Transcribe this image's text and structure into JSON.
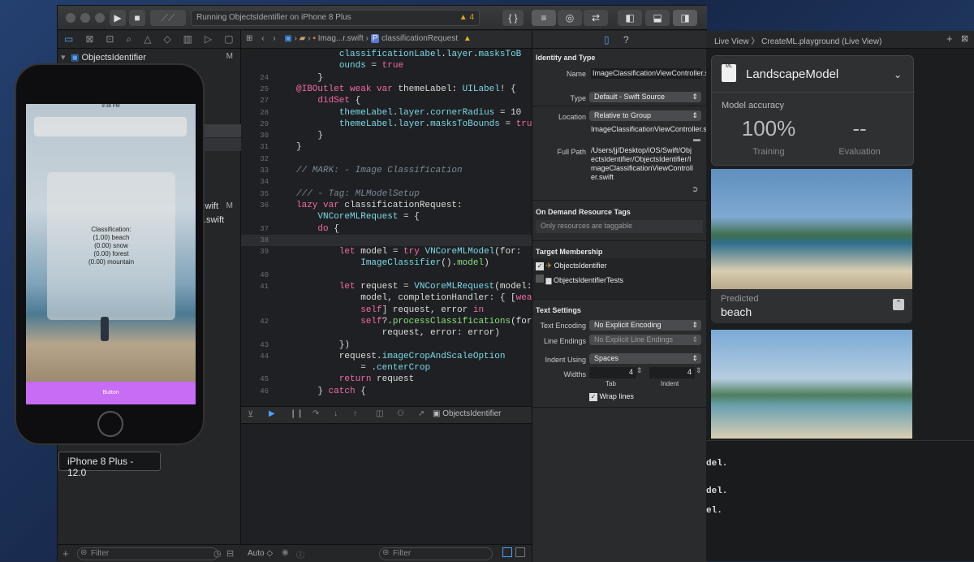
{
  "toolbar": {
    "status": "Running ObjectsIdentifier on iPhone 8 Plus",
    "warning_count": "4",
    "braces": "{ }"
  },
  "navigator": {
    "project": "ObjectsIdentifier",
    "project_badge": "M",
    "rows": [
      {
        "label": "swift",
        "badge": "M"
      },
      {
        "label": ".swift",
        "badge": ""
      }
    ],
    "filter_placeholder": "Filter"
  },
  "editor": {
    "breadcrumb_file": "Imag...r.swift",
    "breadcrumb_symbol": "classificationRequest",
    "lines": [
      {
        "n": "",
        "html": "        <span class=\"ty\">classificationLabel</span>.<span class=\"ty\">layer</span>.<span class=\"ty\">masksToB</span>"
      },
      {
        "n": "",
        "html": "        <span class=\"ty\">ounds</span> = <span class=\"kw\">true</span>"
      },
      {
        "n": "24",
        "html": "    }"
      },
      {
        "n": "25",
        "html": "<span class=\"at\">@IBOutlet weak var</span> themeLabel: <span class=\"ty\">UILabel</span>! {"
      },
      {
        "n": "27",
        "html": "    <span class=\"kw\">didSet</span> {"
      },
      {
        "n": "28",
        "html": "        <span class=\"ty\">themeLabel</span>.<span class=\"ty\">layer</span>.<span class=\"ty\">cornerRadius</span> = 10"
      },
      {
        "n": "29",
        "html": "        <span class=\"ty\">themeLabel</span>.<span class=\"ty\">layer</span>.<span class=\"ty\">masksToBounds</span> = <span class=\"kw\">true</span>"
      },
      {
        "n": "30",
        "html": "    }"
      },
      {
        "n": "31",
        "html": "}"
      },
      {
        "n": "32",
        "html": ""
      },
      {
        "n": "33",
        "html": "<span class=\"cm\">// MARK: - Image Classification</span>"
      },
      {
        "n": "34",
        "html": ""
      },
      {
        "n": "35",
        "html": "<span class=\"cm\">/// - Tag: MLModelSetup</span>"
      },
      {
        "n": "36",
        "html": "<span class=\"kw\">lazy var</span> classificationRequest:"
      },
      {
        "n": "",
        "html": "    <span class=\"ty\">VNCoreMLRequest</span> = {"
      },
      {
        "n": "37",
        "html": "    <span class=\"kw\">do</span> {"
      },
      {
        "n": "38",
        "html": ""
      },
      {
        "n": "39",
        "html": "        <span class=\"kw\">let</span> model = <span class=\"kw\">try</span> <span class=\"ty\">VNCoreMLModel</span>(for:"
      },
      {
        "n": "",
        "html": "            <span class=\"ty\">ImageClassifier</span>().<span class=\"pr\">model</span>)"
      },
      {
        "n": "40",
        "html": ""
      },
      {
        "n": "41",
        "html": "        <span class=\"kw\">let</span> request = <span class=\"ty\">VNCoreMLRequest</span>(model:"
      },
      {
        "n": "",
        "html": "            model, completionHandler: { [<span class=\"kw\">weak</span>"
      },
      {
        "n": "",
        "html": "            <span class=\"kw\">self</span>] request, error <span class=\"kw\">in</span>"
      },
      {
        "n": "42",
        "html": "            <span class=\"kw\">self</span>?.<span class=\"pr\">processClassifications</span>(for:"
      },
      {
        "n": "",
        "html": "                request, error: error)"
      },
      {
        "n": "43",
        "html": "        })"
      },
      {
        "n": "44",
        "html": "        request.<span class=\"ty\">imageCropAndScaleOption</span>"
      },
      {
        "n": "",
        "html": "            = .<span class=\"ty\">centerCrop</span>"
      },
      {
        "n": "45",
        "html": "        <span class=\"kw\">return</span> request"
      },
      {
        "n": "46",
        "html": "    } <span class=\"kw\">catch</span> {"
      }
    ],
    "debug_target": "ObjectsIdentifier",
    "footer_auto": "Auto ◇",
    "footer_filter": "Filter"
  },
  "inspector": {
    "identity_header": "Identity and Type",
    "name_label": "Name",
    "name_value": "ImageClassificationViewController.swift",
    "type_label": "Type",
    "type_value": "Default - Swift Source",
    "location_label": "Location",
    "location_value": "Relative to Group",
    "location_file": "ImageClassificationViewController.swift",
    "fullpath_label": "Full Path",
    "fullpath_value": "/Users/jj/Desktop/iOS/Swift/ObjectsIdentifier/ObjectsIdentifier/ImageClassificationViewController.swift",
    "odr_header": "On Demand Resource Tags",
    "odr_placeholder": "Only resources are taggable",
    "target_header": "Target Membership",
    "targets": [
      "ObjectsIdentifier",
      "ObjectsIdentifierTests"
    ],
    "text_header": "Text Settings",
    "enc_label": "Text Encoding",
    "enc_value": "No Explicit Encoding",
    "le_label": "Line Endings",
    "le_value": "No Explicit Line Endings",
    "indent_label": "Indent Using",
    "indent_value": "Spaces",
    "widths_label": "Widths",
    "tab_value": "4",
    "indent_width_value": "4",
    "tab_caption": "Tab",
    "indent_caption": "Indent",
    "wrap_label": "Wrap lines"
  },
  "simulator": {
    "time": "9:38 PM",
    "classification": "Classification:\n(1.00) beach\n(0.00) snow\n(0.00) forest\n(0.00) mountain",
    "button": "Button",
    "device_label": "iPhone 8 Plus - 12.0"
  },
  "playground": {
    "breadcrumb": "Live View 〉 CreateML.playground (Live View)",
    "model_name": "LandscapeModel",
    "accuracy_label": "Model accuracy",
    "training_value": "100%",
    "training_label": "Training",
    "eval_value": "--",
    "eval_label": "Evaluation",
    "predicted_label": "Predicted",
    "predicted_value": "beach",
    "console": [
      "del.",
      "del.",
      "el."
    ]
  }
}
